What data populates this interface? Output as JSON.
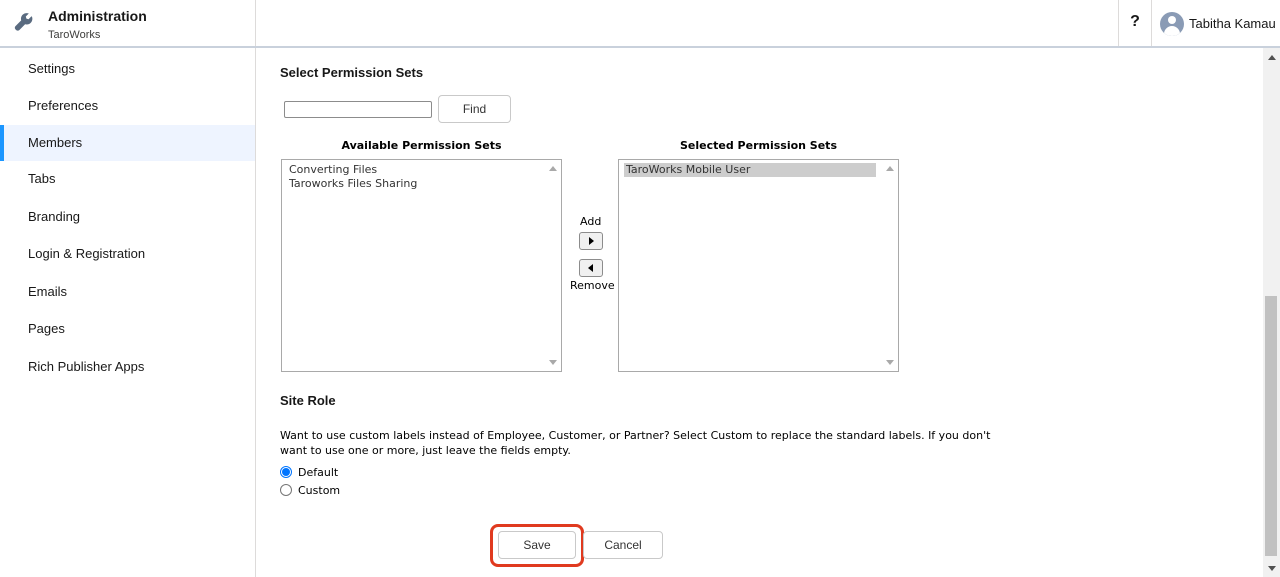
{
  "header": {
    "title": "Administration",
    "subtitle": "TaroWorks",
    "help_label": "?",
    "user_name": "Tabitha Kamau"
  },
  "sidebar": {
    "items": [
      {
        "label": "Settings"
      },
      {
        "label": "Preferences"
      },
      {
        "label": "Members",
        "active": true
      },
      {
        "label": "Tabs"
      },
      {
        "label": "Branding"
      },
      {
        "label": "Login & Registration"
      },
      {
        "label": "Emails"
      },
      {
        "label": "Pages"
      },
      {
        "label": "Rich Publisher Apps"
      }
    ]
  },
  "permission_sets": {
    "title": "Select Permission Sets",
    "search_value": "",
    "find_label": "Find",
    "available_label": "Available Permission Sets",
    "available": [
      "Converting Files",
      "Taroworks Files Sharing"
    ],
    "selected_label": "Selected Permission Sets",
    "selected": [
      "TaroWorks Mobile User"
    ],
    "add_label": "Add",
    "remove_label": "Remove"
  },
  "site_role": {
    "title": "Site Role",
    "description": "Want to use custom labels instead of Employee, Customer, or Partner? Select Custom to replace the standard labels. If you don't want to use one or more, just leave the fields empty.",
    "options": [
      {
        "label": "Default",
        "checked": true
      },
      {
        "label": "Custom",
        "checked": false
      }
    ]
  },
  "actions": {
    "save_label": "Save",
    "cancel_label": "Cancel"
  },
  "colors": {
    "accent": "#1b96ff",
    "highlight": "#e03a1f",
    "radio": "#0075ff"
  }
}
